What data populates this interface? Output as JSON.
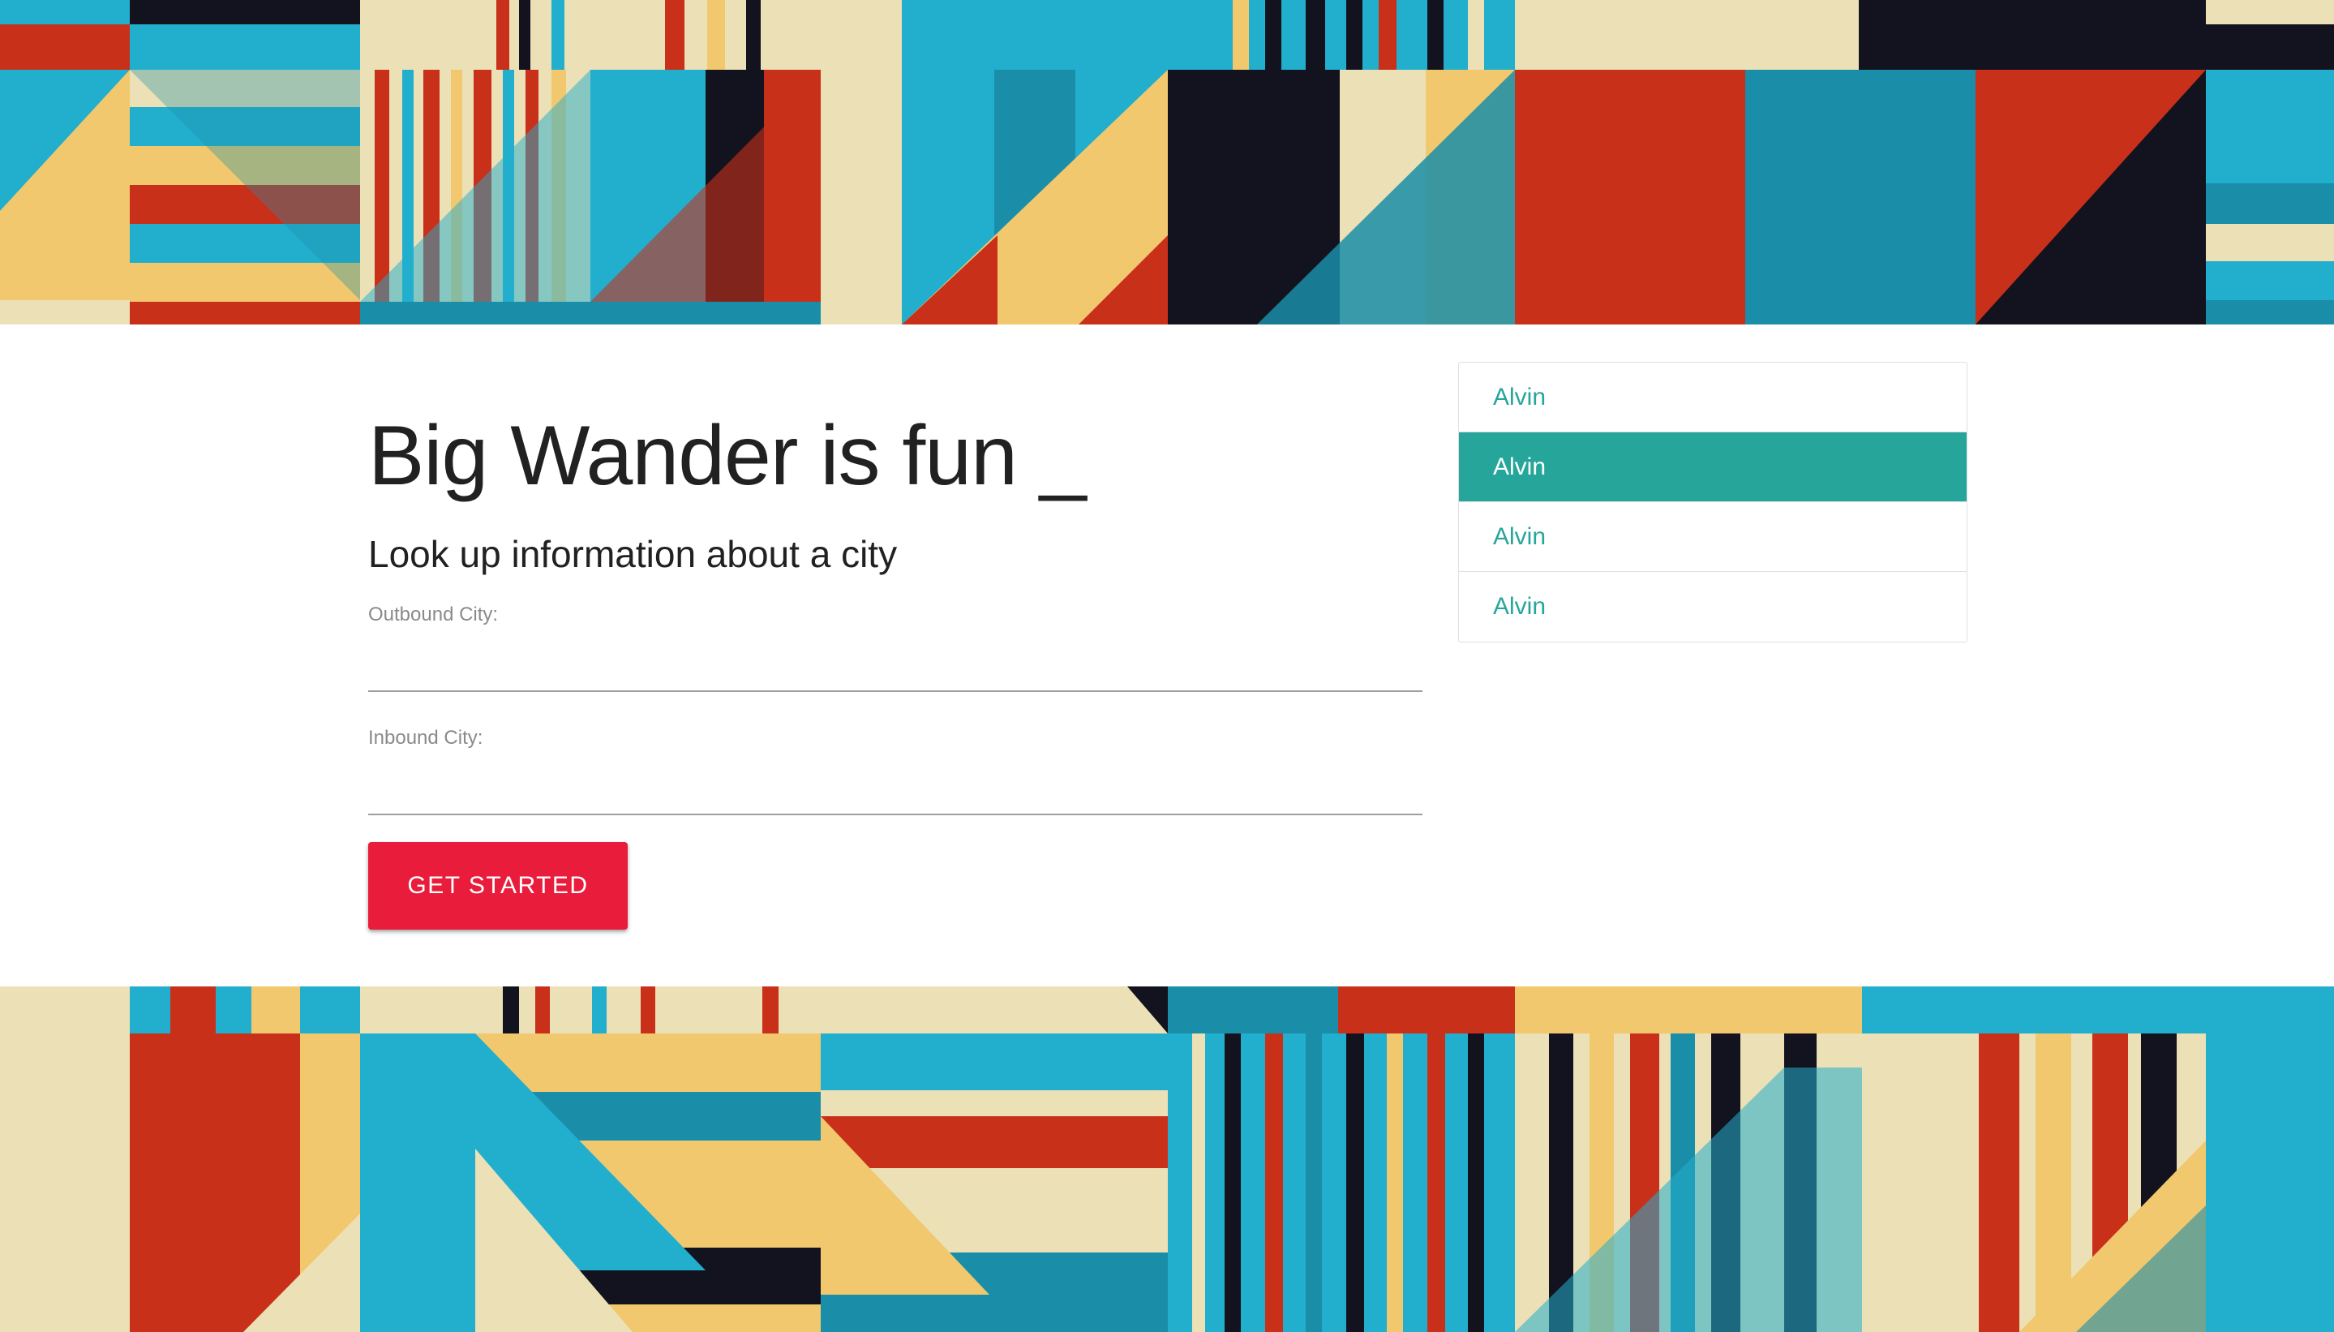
{
  "hero": {
    "title": "Big Wander is fun _",
    "subtitle": "Look up information about a city"
  },
  "form": {
    "outbound_label": "Outbound City:",
    "outbound_value": "",
    "inbound_label": "Inbound City:",
    "inbound_value": "",
    "submit_label": "GET STARTED"
  },
  "city_list": {
    "items": [
      {
        "label": "Alvin",
        "active": false
      },
      {
        "label": "Alvin",
        "active": true
      },
      {
        "label": "Alvin",
        "active": false
      },
      {
        "label": "Alvin",
        "active": false
      }
    ]
  },
  "colors": {
    "accent_teal": "#26a69a",
    "button_red": "#e91c3c",
    "pattern": [
      "#c9301a",
      "#22aecd",
      "#1a8ea8",
      "#f2c86e",
      "#ebe0b6",
      "#13131f"
    ]
  }
}
